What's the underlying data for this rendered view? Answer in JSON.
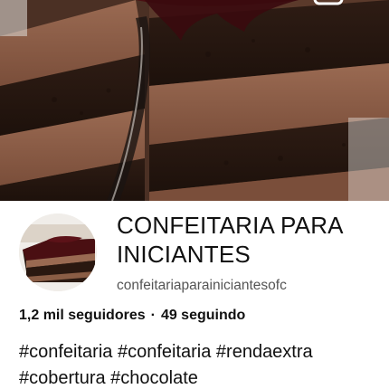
{
  "profile": {
    "name": "CONFEITARIA PARA INICIANTES",
    "handle": "confeitariaparainiciantesofc",
    "followers": "1,2 mil seguidores",
    "separator": "·",
    "following": "49 seguindo",
    "bio_line1": "#confeitaria #confeitaria #rendaextra",
    "bio_line2": "#cobertura #chocolate"
  },
  "icons": {
    "back": "back-arrow-icon",
    "more": "more-options-icon"
  },
  "colors": {
    "chocolate_dark": "#2a1a12",
    "chocolate_mousse": "#8a5d45",
    "ganache": "#4a0f12"
  }
}
